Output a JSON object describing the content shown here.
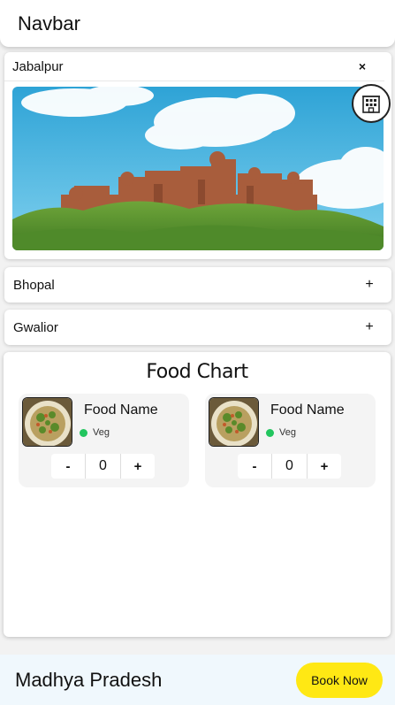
{
  "navbar": {
    "title": "Navbar"
  },
  "accordion": {
    "expanded": {
      "label": "Jabalpur",
      "toggle": "×"
    },
    "collapsed": [
      {
        "label": "Bhopal",
        "toggle": "+"
      },
      {
        "label": "Gwalior",
        "toggle": "+"
      }
    ]
  },
  "food_chart": {
    "title": "Food Chart",
    "items": [
      {
        "name": "Food Name",
        "type": "Veg",
        "qty": "0",
        "minus": "-",
        "plus": "+"
      },
      {
        "name": "Food Name",
        "type": "Veg",
        "qty": "0",
        "minus": "-",
        "plus": "+"
      }
    ]
  },
  "footer": {
    "title": "Madhya Pradesh",
    "button": "Book Now"
  },
  "colors": {
    "veg": "#22c55e",
    "book_button": "#ffe814",
    "footer_bg": "#f0f8fd"
  },
  "icons": {
    "hotel": "hotel-building-icon"
  }
}
